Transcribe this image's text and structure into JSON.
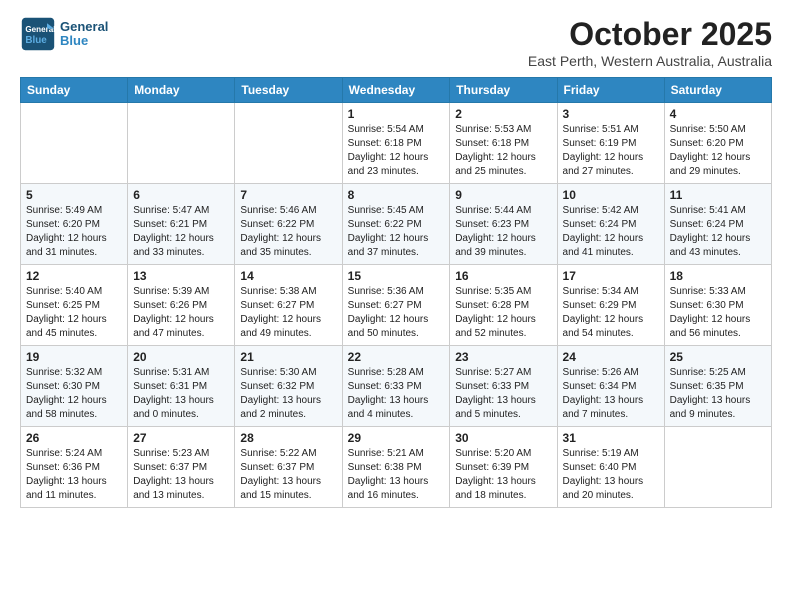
{
  "header": {
    "logo_general": "General",
    "logo_blue": "Blue",
    "month": "October 2025",
    "location": "East Perth, Western Australia, Australia"
  },
  "weekdays": [
    "Sunday",
    "Monday",
    "Tuesday",
    "Wednesday",
    "Thursday",
    "Friday",
    "Saturday"
  ],
  "weeks": [
    [
      {
        "day": "",
        "info": ""
      },
      {
        "day": "",
        "info": ""
      },
      {
        "day": "",
        "info": ""
      },
      {
        "day": "1",
        "info": "Sunrise: 5:54 AM\nSunset: 6:18 PM\nDaylight: 12 hours\nand 23 minutes."
      },
      {
        "day": "2",
        "info": "Sunrise: 5:53 AM\nSunset: 6:18 PM\nDaylight: 12 hours\nand 25 minutes."
      },
      {
        "day": "3",
        "info": "Sunrise: 5:51 AM\nSunset: 6:19 PM\nDaylight: 12 hours\nand 27 minutes."
      },
      {
        "day": "4",
        "info": "Sunrise: 5:50 AM\nSunset: 6:20 PM\nDaylight: 12 hours\nand 29 minutes."
      }
    ],
    [
      {
        "day": "5",
        "info": "Sunrise: 5:49 AM\nSunset: 6:20 PM\nDaylight: 12 hours\nand 31 minutes."
      },
      {
        "day": "6",
        "info": "Sunrise: 5:47 AM\nSunset: 6:21 PM\nDaylight: 12 hours\nand 33 minutes."
      },
      {
        "day": "7",
        "info": "Sunrise: 5:46 AM\nSunset: 6:22 PM\nDaylight: 12 hours\nand 35 minutes."
      },
      {
        "day": "8",
        "info": "Sunrise: 5:45 AM\nSunset: 6:22 PM\nDaylight: 12 hours\nand 37 minutes."
      },
      {
        "day": "9",
        "info": "Sunrise: 5:44 AM\nSunset: 6:23 PM\nDaylight: 12 hours\nand 39 minutes."
      },
      {
        "day": "10",
        "info": "Sunrise: 5:42 AM\nSunset: 6:24 PM\nDaylight: 12 hours\nand 41 minutes."
      },
      {
        "day": "11",
        "info": "Sunrise: 5:41 AM\nSunset: 6:24 PM\nDaylight: 12 hours\nand 43 minutes."
      }
    ],
    [
      {
        "day": "12",
        "info": "Sunrise: 5:40 AM\nSunset: 6:25 PM\nDaylight: 12 hours\nand 45 minutes."
      },
      {
        "day": "13",
        "info": "Sunrise: 5:39 AM\nSunset: 6:26 PM\nDaylight: 12 hours\nand 47 minutes."
      },
      {
        "day": "14",
        "info": "Sunrise: 5:38 AM\nSunset: 6:27 PM\nDaylight: 12 hours\nand 49 minutes."
      },
      {
        "day": "15",
        "info": "Sunrise: 5:36 AM\nSunset: 6:27 PM\nDaylight: 12 hours\nand 50 minutes."
      },
      {
        "day": "16",
        "info": "Sunrise: 5:35 AM\nSunset: 6:28 PM\nDaylight: 12 hours\nand 52 minutes."
      },
      {
        "day": "17",
        "info": "Sunrise: 5:34 AM\nSunset: 6:29 PM\nDaylight: 12 hours\nand 54 minutes."
      },
      {
        "day": "18",
        "info": "Sunrise: 5:33 AM\nSunset: 6:30 PM\nDaylight: 12 hours\nand 56 minutes."
      }
    ],
    [
      {
        "day": "19",
        "info": "Sunrise: 5:32 AM\nSunset: 6:30 PM\nDaylight: 12 hours\nand 58 minutes."
      },
      {
        "day": "20",
        "info": "Sunrise: 5:31 AM\nSunset: 6:31 PM\nDaylight: 13 hours\nand 0 minutes."
      },
      {
        "day": "21",
        "info": "Sunrise: 5:30 AM\nSunset: 6:32 PM\nDaylight: 13 hours\nand 2 minutes."
      },
      {
        "day": "22",
        "info": "Sunrise: 5:28 AM\nSunset: 6:33 PM\nDaylight: 13 hours\nand 4 minutes."
      },
      {
        "day": "23",
        "info": "Sunrise: 5:27 AM\nSunset: 6:33 PM\nDaylight: 13 hours\nand 5 minutes."
      },
      {
        "day": "24",
        "info": "Sunrise: 5:26 AM\nSunset: 6:34 PM\nDaylight: 13 hours\nand 7 minutes."
      },
      {
        "day": "25",
        "info": "Sunrise: 5:25 AM\nSunset: 6:35 PM\nDaylight: 13 hours\nand 9 minutes."
      }
    ],
    [
      {
        "day": "26",
        "info": "Sunrise: 5:24 AM\nSunset: 6:36 PM\nDaylight: 13 hours\nand 11 minutes."
      },
      {
        "day": "27",
        "info": "Sunrise: 5:23 AM\nSunset: 6:37 PM\nDaylight: 13 hours\nand 13 minutes."
      },
      {
        "day": "28",
        "info": "Sunrise: 5:22 AM\nSunset: 6:37 PM\nDaylight: 13 hours\nand 15 minutes."
      },
      {
        "day": "29",
        "info": "Sunrise: 5:21 AM\nSunset: 6:38 PM\nDaylight: 13 hours\nand 16 minutes."
      },
      {
        "day": "30",
        "info": "Sunrise: 5:20 AM\nSunset: 6:39 PM\nDaylight: 13 hours\nand 18 minutes."
      },
      {
        "day": "31",
        "info": "Sunrise: 5:19 AM\nSunset: 6:40 PM\nDaylight: 13 hours\nand 20 minutes."
      },
      {
        "day": "",
        "info": ""
      }
    ]
  ]
}
